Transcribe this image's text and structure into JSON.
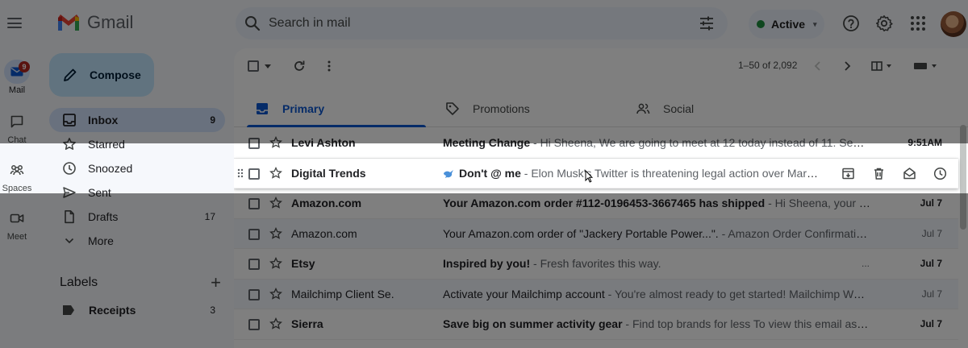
{
  "app": {
    "name": "Gmail"
  },
  "search": {
    "placeholder": "Search in mail"
  },
  "status": {
    "label": "Active",
    "color": "#1e8e3e"
  },
  "rail": [
    {
      "label": "Mail",
      "icon": "mail-icon",
      "badge": "9",
      "active": true
    },
    {
      "label": "Chat",
      "icon": "chat-icon"
    },
    {
      "label": "Spaces",
      "icon": "spaces-icon"
    },
    {
      "label": "Meet",
      "icon": "video-icon"
    }
  ],
  "compose": {
    "label": "Compose"
  },
  "nav": [
    {
      "label": "Inbox",
      "count": "9",
      "icon": "inbox-icon",
      "active": true
    },
    {
      "label": "Starred",
      "count": "",
      "icon": "star-icon"
    },
    {
      "label": "Snoozed",
      "count": "",
      "icon": "clock-icon"
    },
    {
      "label": "Sent",
      "count": "",
      "icon": "send-icon"
    },
    {
      "label": "Drafts",
      "count": "17",
      "icon": "draft-icon"
    },
    {
      "label": "More",
      "count": "",
      "icon": "chevron-down-icon"
    }
  ],
  "labels": {
    "title": "Labels",
    "items": [
      {
        "label": "Receipts",
        "count": "3"
      }
    ]
  },
  "toolbar": {
    "pagination": "1–50 of 2,092"
  },
  "tabs": [
    {
      "label": "Primary",
      "icon": "inbox-icon",
      "active": true
    },
    {
      "label": "Promotions",
      "icon": "tag-icon"
    },
    {
      "label": "Social",
      "icon": "people-icon"
    }
  ],
  "emails": [
    {
      "sender": "Levi Ashton",
      "subject": "Meeting Change",
      "snippet": " - Hi Sheena, We are going to meet at 12 today instead of 11. See you t...",
      "date": "9:51AM",
      "unread": true
    },
    {
      "sender": "Digital Trends",
      "subject": "Don't @ me",
      "snippet": " - Elon Musk's Twitter is threatening legal action over Mark Zu...",
      "date": "",
      "unread": true,
      "hover": true
    },
    {
      "sender": "Amazon.com",
      "subject": "Your Amazon.com order #112-0196453-3667465 has shipped",
      "snippet": " - Hi Sheena, your pack...",
      "date": "Jul 7",
      "unread": true
    },
    {
      "sender": "Amazon.com",
      "subject": "Your Amazon.com order of \"Jackery Portable Power...\".",
      "snippet": " - Amazon Order Confirmation H...",
      "date": "Jul 7",
      "unread": false
    },
    {
      "sender": "Etsy",
      "subject": "Inspired by you!",
      "snippet": " - Fresh favorites this way.",
      "date": "Jul 7",
      "unread": true,
      "dots": "..."
    },
    {
      "sender": "Mailchimp Client Se.",
      "subject": "Activate your Mailchimp account",
      "snippet": " - You're almost ready to get started! Mailchimp We're ...",
      "date": "Jul 7",
      "unread": false
    },
    {
      "sender": "Sierra",
      "subject": "Save big on summer activity gear",
      "snippet": " - Find top brands for less To view this email as a we...",
      "date": "Jul 7",
      "unread": true
    }
  ],
  "colors": {
    "accent": "#0b57d0",
    "compose_bg": "#c2e7ff",
    "selected_bg": "#d3e3fd",
    "badge": "#b3261e"
  }
}
